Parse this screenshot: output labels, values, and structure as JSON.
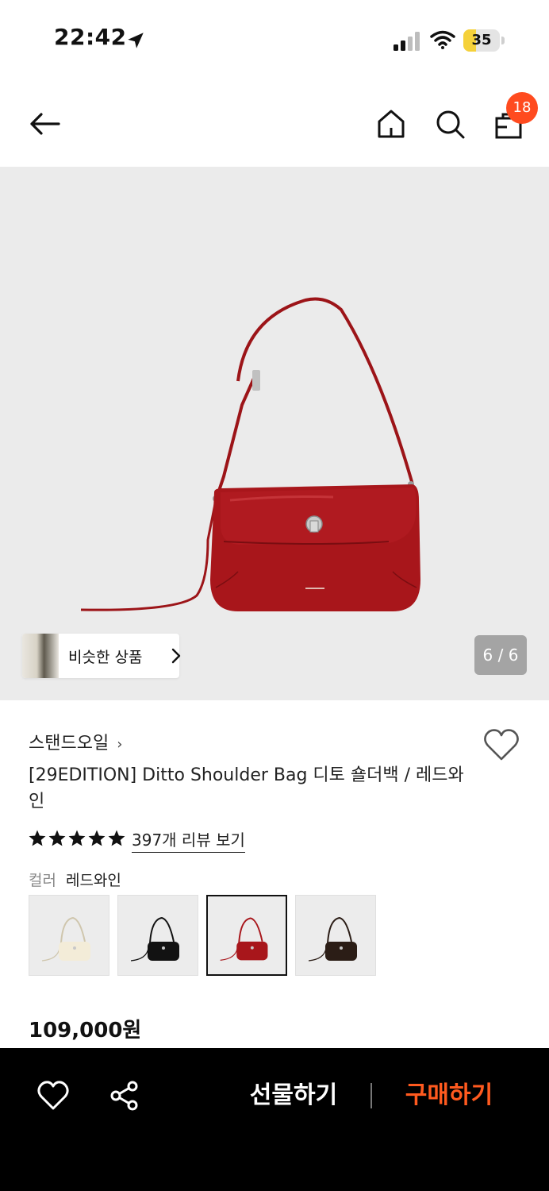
{
  "status_bar": {
    "time": "22:42",
    "battery_level": "35",
    "battery_fraction": 0.35,
    "battery_color": "#f5d13a"
  },
  "nav": {
    "back_icon": "arrow-left-icon",
    "home_icon": "home-icon",
    "search_icon": "search-icon",
    "cart_icon": "shopping-bag-icon",
    "cart_count": "18",
    "badge_color": "#ff4b1f"
  },
  "gallery": {
    "similar_label": "비슷한 상품",
    "page_counter": "6 / 6",
    "bag_color": "#a8161b",
    "background": "#ebebeb"
  },
  "product": {
    "brand": "스탠드오일",
    "title": "[29EDITION] Ditto Shoulder Bag 디토 숄더백 / 레드와인",
    "review_link": "397개 리뷰 보기",
    "rating_stars": 5,
    "color_key": "컬러",
    "color_value": "레드와인",
    "price": "109,000원"
  },
  "swatches": [
    {
      "name": "cream",
      "color": "#f3ecd8",
      "selected": false
    },
    {
      "name": "black",
      "color": "#121212",
      "selected": false
    },
    {
      "name": "red-wine",
      "color": "#a8161b",
      "selected": true
    },
    {
      "name": "dark-brown",
      "color": "#2b1d16",
      "selected": false
    }
  ],
  "bottom_bar": {
    "gift_label": "선물하기",
    "buy_label": "구매하기",
    "buy_color": "#ff5a1f",
    "heart_icon": "heart-outline-icon",
    "share_icon": "share-icon"
  }
}
